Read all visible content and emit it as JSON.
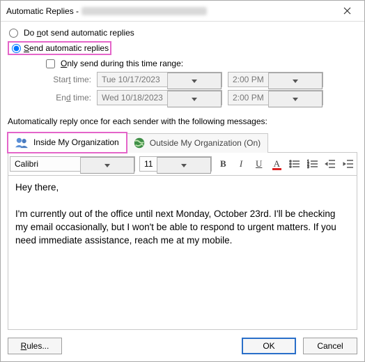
{
  "title": "Automatic Replies - ",
  "radios": {
    "do_not_send": "Do not send automatic replies",
    "send": "Send automatic replies",
    "selected": "send"
  },
  "range": {
    "only_send": "Only send during this time range:",
    "checked": false,
    "start_label": "Start time:",
    "end_label": "End time:",
    "start_date": "Tue 10/17/2023",
    "start_time": "2:00 PM",
    "end_date": "Wed 10/18/2023",
    "end_time": "2:00 PM"
  },
  "section_label": "Automatically reply once for each sender with the following messages:",
  "tabs": {
    "inside": "Inside My Organization",
    "outside": "Outside My Organization (On)",
    "active": "inside"
  },
  "format": {
    "font": "Calibri",
    "size": "11"
  },
  "message": {
    "line1": "Hey there,",
    "body": "I'm currently out of the office until next Monday, October 23rd. I'll be checking my email occasionally, but I won't be able to respond to urgent matters. If you need immediate assistance, reach me at my mobile."
  },
  "buttons": {
    "rules": "Rules...",
    "ok": "OK",
    "cancel": "Cancel"
  }
}
